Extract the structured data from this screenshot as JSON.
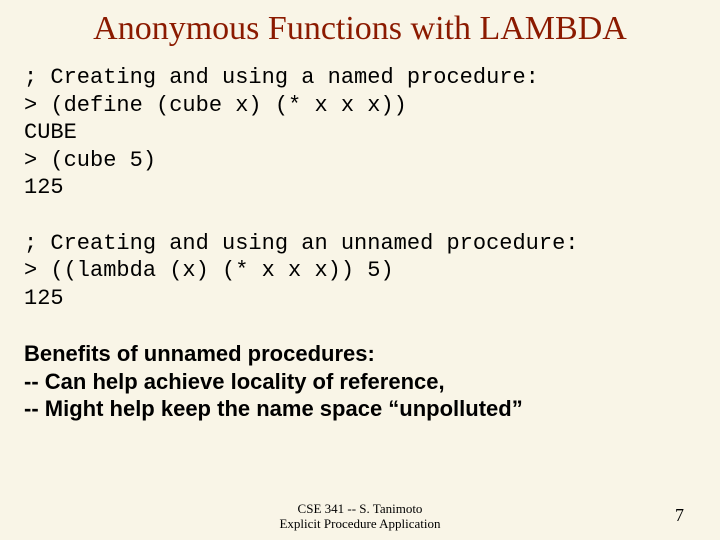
{
  "title": "Anonymous Functions with LAMBDA",
  "code_block_1": "; Creating and using a named procedure:\n> (define (cube x) (* x x x))\nCUBE\n> (cube 5)\n125",
  "code_block_2": "; Creating and using an unnamed procedure:\n> ((lambda (x) (* x x x)) 5)\n125",
  "benefits": {
    "heading": "Benefits of unnamed procedures:",
    "line1": "-- Can help achieve locality of reference,",
    "line2": "-- Might help keep the name space “unpolluted”"
  },
  "footer": {
    "line1": "CSE 341 -- S. Tanimoto",
    "line2": "Explicit Procedure Application"
  },
  "page_number": "7"
}
